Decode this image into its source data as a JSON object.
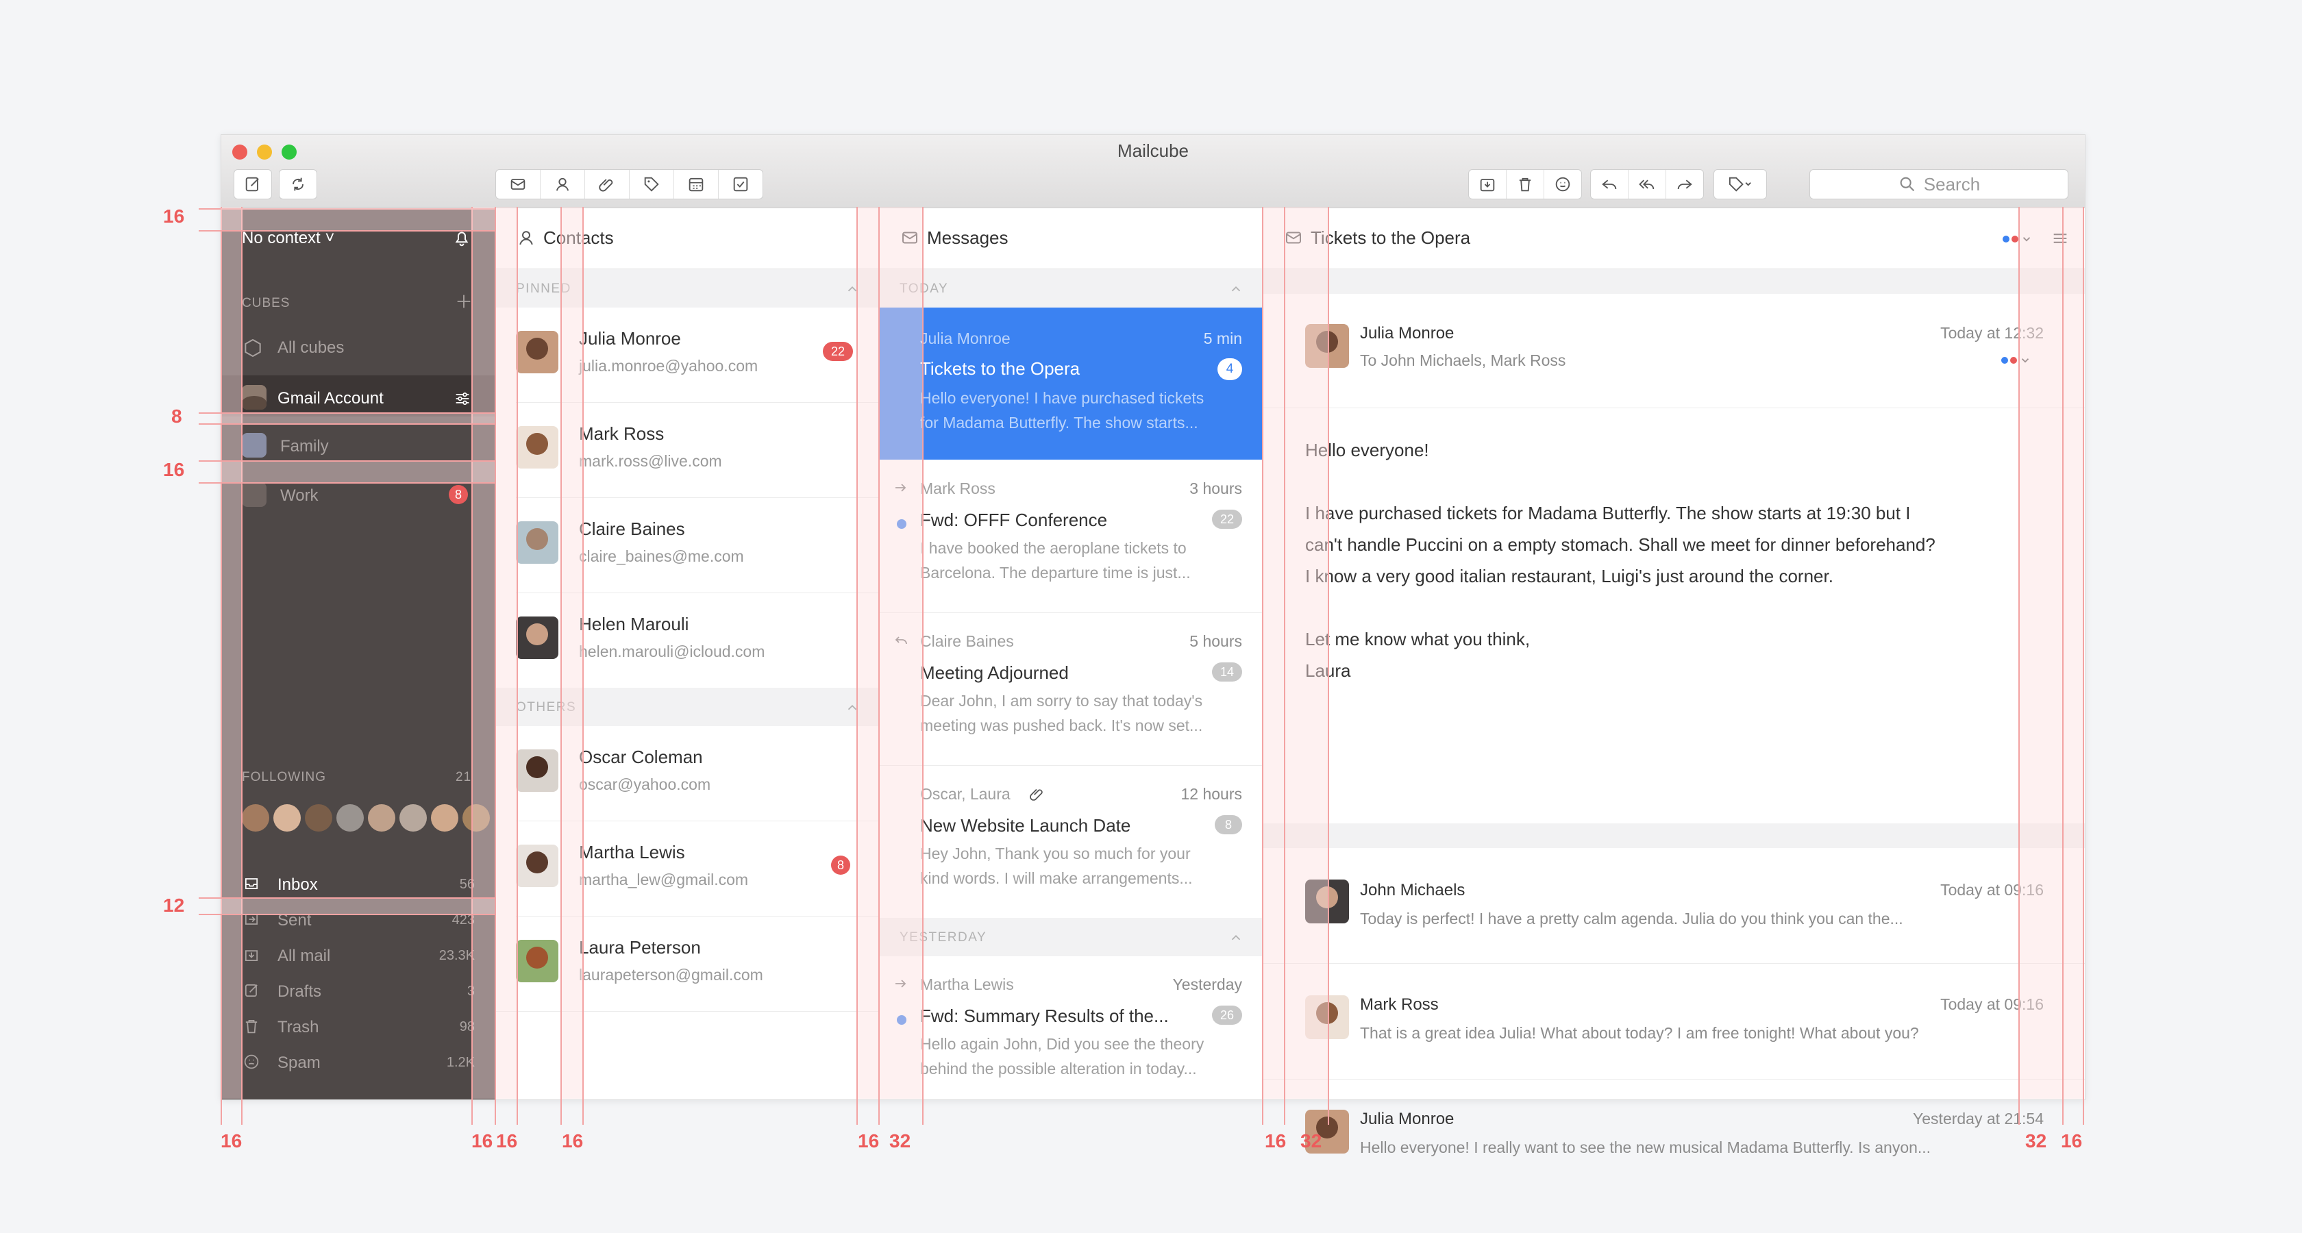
{
  "window": {
    "title": "Mailcube"
  },
  "toolbar": {
    "compose_icon": "compose-icon",
    "sync_icon": "sync-icon",
    "view_icons": [
      "envelope-icon",
      "person-icon",
      "paperclip-icon",
      "tag-icon",
      "calendar-icon",
      "checkbox-icon"
    ],
    "action_icons": [
      "archive-icon",
      "trash-icon",
      "snooze-icon",
      "reply-icon",
      "reply-all-icon",
      "forward-icon",
      "tag-dropdown-icon"
    ],
    "search_placeholder": "Search"
  },
  "sidebar": {
    "context": "No context ˅",
    "cubes_label": "CUBES",
    "cubes": [
      {
        "label": "All cubes"
      },
      {
        "label": "Gmail Account"
      },
      {
        "label": "Family"
      },
      {
        "label": "Work",
        "badge": "8"
      }
    ],
    "following_label": "FOLLOWING",
    "following_count": "21",
    "folders": [
      {
        "label": "Inbox",
        "count": "56"
      },
      {
        "label": "Sent",
        "count": "423"
      },
      {
        "label": "All mail",
        "count": "23.3K"
      },
      {
        "label": "Drafts",
        "count": "3"
      },
      {
        "label": "Trash",
        "count": "98"
      },
      {
        "label": "Spam",
        "count": "1.2K"
      }
    ]
  },
  "contacts": {
    "title": "Contacts",
    "pinned_label": "PINNED",
    "others_label": "OTHERS",
    "pinned": [
      {
        "name": "Julia Monroe",
        "email": "julia.monroe@yahoo.com",
        "badge": "22"
      },
      {
        "name": "Mark Ross",
        "email": "mark.ross@live.com"
      },
      {
        "name": "Claire Baines",
        "email": "claire_baines@me.com"
      },
      {
        "name": "Helen Marouli",
        "email": "helen.marouli@icloud.com"
      }
    ],
    "others": [
      {
        "name": "Oscar Coleman",
        "email": "oscar@yahoo.com"
      },
      {
        "name": "Martha Lewis",
        "email": "martha_lew@gmail.com",
        "badge": "8"
      },
      {
        "name": "Laura Peterson",
        "email": "laurapeterson@gmail.com"
      }
    ]
  },
  "messages": {
    "title": "Messages",
    "today_label": "TODAY",
    "yesterday_label": "YESTERDAY",
    "items": [
      {
        "from": "Julia Monroe",
        "time": "5 min",
        "subject": "Tickets to the Opera",
        "count": "4",
        "preview1": "Hello everyone! I have purchased tickets",
        "preview2": "for Madama Butterfly. The show starts..."
      },
      {
        "from": "Mark Ross",
        "time": "3 hours",
        "subject": "Fwd: OFFF Conference",
        "count": "22",
        "preview1": "I have booked the aeroplane tickets to",
        "preview2": "Barcelona. The departure time is just..."
      },
      {
        "from": "Claire Baines",
        "time": "5 hours",
        "subject": "Meeting Adjourned",
        "count": "14",
        "preview1": "Dear John, I am sorry to say that today's",
        "preview2": "meeting was pushed back. It's now set..."
      },
      {
        "from": "Oscar, Laura",
        "time": "12 hours",
        "subject": "New Website Launch Date",
        "count": "8",
        "preview1": "Hey John, Thank you so much for your",
        "preview2": "kind words. I will make arrangements..."
      },
      {
        "from": "Martha Lewis",
        "time": "Yesterday",
        "subject": "Fwd: Summary Results of the...",
        "count": "26",
        "preview1": "Hello again John, Did you see the theory",
        "preview2": "behind the possible alteration in today..."
      }
    ]
  },
  "reader": {
    "title": "Tickets to the Opera",
    "main": {
      "from": "Julia Monroe",
      "to": "To John Michaels, Mark Ross",
      "time": "Today at 12:32",
      "body": [
        "Hello everyone!",
        "I have purchased tickets for Madama Butterfly. The show starts at 19:30 but I",
        "can't handle Puccini on a empty stomach. Shall we meet for dinner beforehand?",
        "I know a very good italian restaurant, Luigi's just around the corner.",
        "Let me know what you think,",
        "Laura"
      ]
    },
    "thread": [
      {
        "from": "John Michaels",
        "time": "Today at 09:16",
        "preview": "Today is perfect! I have a pretty calm agenda. Julia do you think you can the..."
      },
      {
        "from": "Mark Ross",
        "time": "Today at 09:16",
        "preview": "That is a great idea Julia! What about today? I am free tonight! What about you?"
      },
      {
        "from": "Julia Monroe",
        "time": "Yesterday at 21:54",
        "preview": "Hello everyone! I really want to see the new musical Madama Butterfly. Is anyon..."
      }
    ]
  },
  "annotations": {
    "left": [
      "16",
      "8",
      "16",
      "12"
    ],
    "bottom": [
      "16",
      "16",
      "16",
      "16",
      "16",
      "32",
      "16",
      "32",
      "32",
      "16"
    ]
  },
  "colors": {
    "accent": "#3b82f2",
    "sidebar": "#4e4847",
    "badge_red": "#e85a5a",
    "guide": "#f3a3a3"
  }
}
